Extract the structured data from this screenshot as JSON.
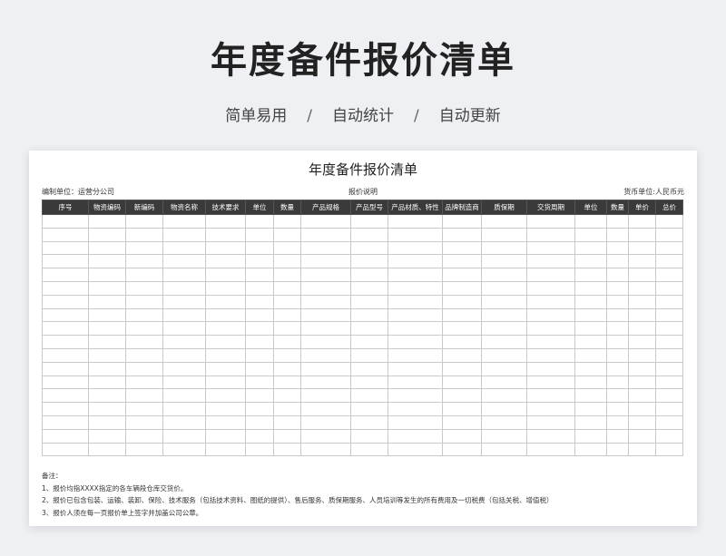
{
  "hero": {
    "title": "年度备件报价清单",
    "taglines": [
      "简单易用",
      "自动统计",
      "自动更新"
    ],
    "separator": "/"
  },
  "sheet": {
    "title": "年度备件报价清单",
    "prepared_by": "编制单位：运营分公司",
    "quote_note": "报价说明",
    "currency": "货币单位:人民币元",
    "columns": [
      "序号",
      "物资编码",
      "新编码",
      "物资名称",
      "技术要求",
      "单位",
      "数量",
      "产品规格",
      "产品型号",
      "产品材质、特性",
      "品牌制造商",
      "质保期",
      "交货周期",
      "单位",
      "数量",
      "单价",
      "总价"
    ],
    "empty_rows": 18,
    "notes_title": "备注：",
    "notes": [
      "1、报价均指XXXX指定的各车辆段仓库交货价。",
      "2、报价已包含包装、运输、装卸、保险、技术服务（包括技术资料、图纸的提供）、售后服务、质保期服务、人员培训等发生的所有费用及一切税费（包括关税、增值税）",
      "3、报价人须在每一页报价单上签字并加盖公司公章。"
    ]
  }
}
